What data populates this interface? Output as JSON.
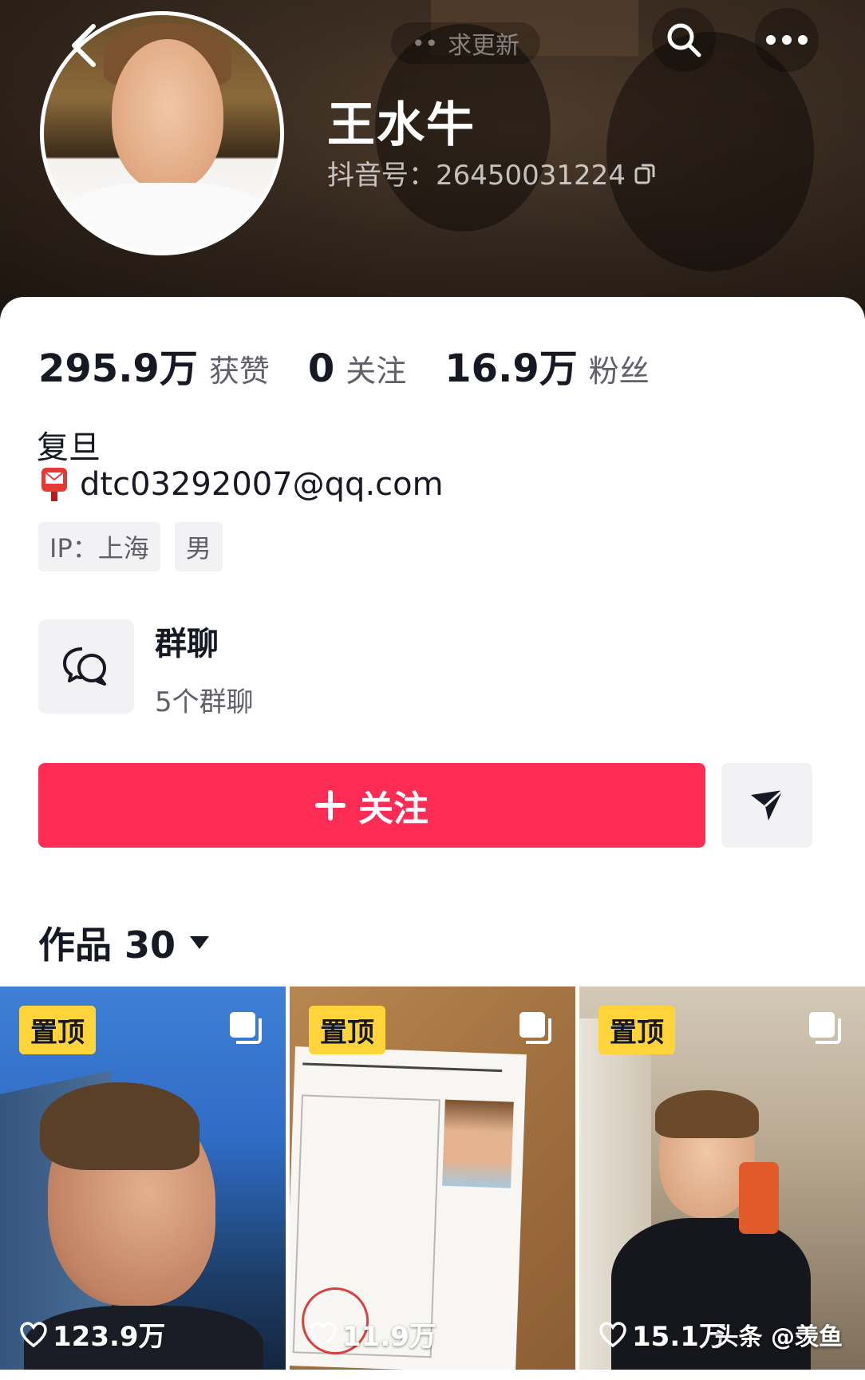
{
  "header": {
    "update_label": "求更新",
    "username": "王水牛",
    "douyin_id": "抖音号：26450031224"
  },
  "stats": [
    {
      "value": "295.9万",
      "label": "获赞"
    },
    {
      "value": "0",
      "label": "关注"
    },
    {
      "value": "16.9万",
      "label": "粉丝"
    }
  ],
  "profile": {
    "bio": "复旦",
    "email": "dtc03292007@qq.com",
    "tags": [
      "IP：上海",
      "男"
    ]
  },
  "group_chat": {
    "title": "群聊",
    "subtitle": "5个群聊"
  },
  "actions": {
    "follow_label": "关注"
  },
  "works": {
    "label": "作品 30",
    "items": [
      {
        "pin_label": "置顶",
        "likes": "123.9万"
      },
      {
        "pin_label": "置顶",
        "likes": "11.9万"
      },
      {
        "pin_label": "置顶",
        "likes": "15.1万"
      }
    ]
  },
  "watermark": "头条 @羡鱼",
  "colors": {
    "accent": "#fe2c55",
    "pin_badge": "#ffd43b",
    "text_primary": "#161823",
    "text_secondary": "#5f6069"
  }
}
